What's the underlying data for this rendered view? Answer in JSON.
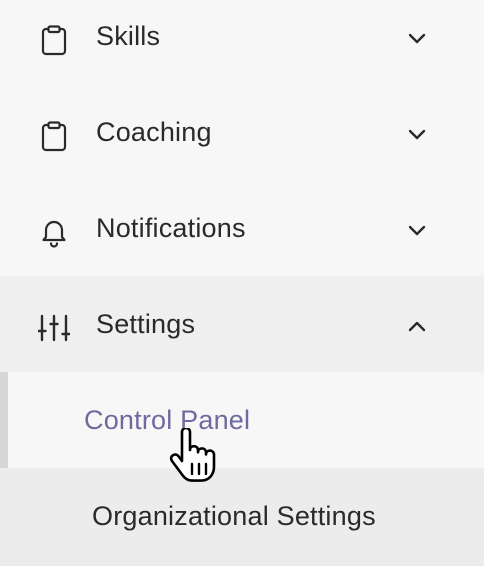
{
  "nav": {
    "items": [
      {
        "label": "Skills",
        "icon": "clipboard-icon",
        "chevron": "chevron-down-icon"
      },
      {
        "label": "Coaching",
        "icon": "clipboard-icon",
        "chevron": "chevron-down-icon"
      },
      {
        "label": "Notifications",
        "icon": "bell-icon",
        "chevron": "chevron-down-icon"
      },
      {
        "label": "Settings",
        "icon": "sliders-icon",
        "chevron": "chevron-up-icon",
        "expanded": true
      }
    ],
    "settings_submenu": [
      {
        "label": "Control Panel",
        "active": true
      },
      {
        "label": "Organizational Settings"
      }
    ]
  },
  "colors": {
    "background": "#f7f7f7",
    "expanded_header_bg": "#efefef",
    "hover_row_bg": "#ececec",
    "active_link": "#6f6a9e",
    "text": "#2a2a2a"
  },
  "cursor": {
    "icon": "hand-pointer-icon"
  }
}
